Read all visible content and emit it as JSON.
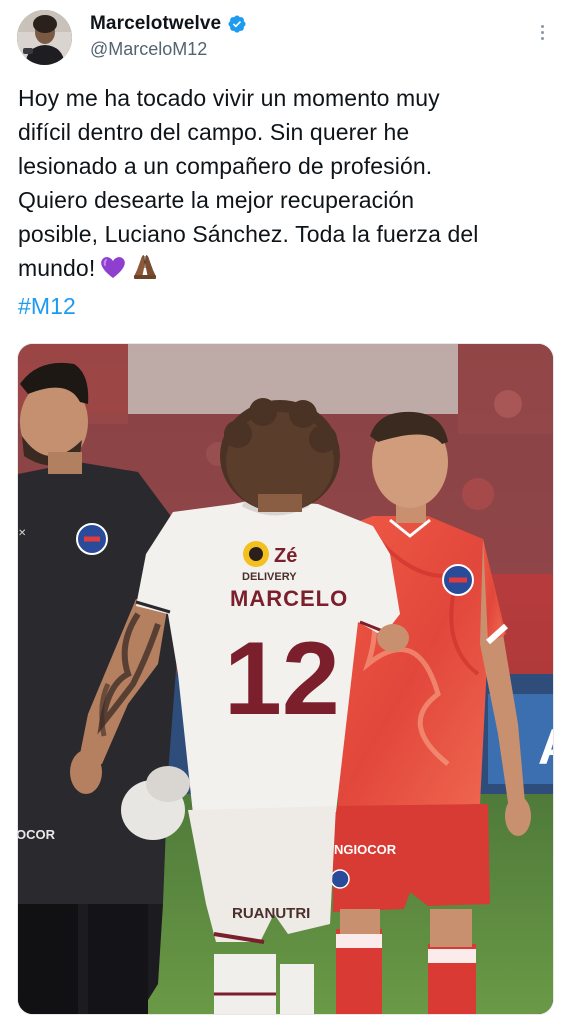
{
  "author": {
    "display_name": "Marcelotwelve",
    "handle": "@MarceloM12",
    "verified": true,
    "verified_icon": "verified-badge-icon",
    "avatar": "profile-photo"
  },
  "menu": {
    "icon": "more-options-icon"
  },
  "tweet": {
    "lines": [
      "Hoy me ha tocado vivir un momento muy",
      "difícil dentro del campo. Sin querer he",
      "lesionado a un compañero de profesión.",
      "Quiero desearte la mejor recuperación",
      "posible, Luciano Sánchez. Toda la fuerza del",
      "mundo!"
    ],
    "emojis": [
      "purple-heart-emoji",
      "folded-hands-emoji"
    ],
    "hashtag": "#M12"
  },
  "photo": {
    "jersey_name": "MARCELO",
    "jersey_number": "12",
    "sponsor_text": "DELIVERY",
    "sponsor_logo": "Zé",
    "shorts_text": "RUANUTRI",
    "left_shorts_text": "OCOR",
    "red_shorts_text": "NGIOCOR",
    "colors": {
      "hashtag": "#1d9bf0",
      "verified": "#1d9bf0",
      "handle": "#536471",
      "red_kit": "#e8473b",
      "maroon_number": "#7a1f2b"
    }
  }
}
